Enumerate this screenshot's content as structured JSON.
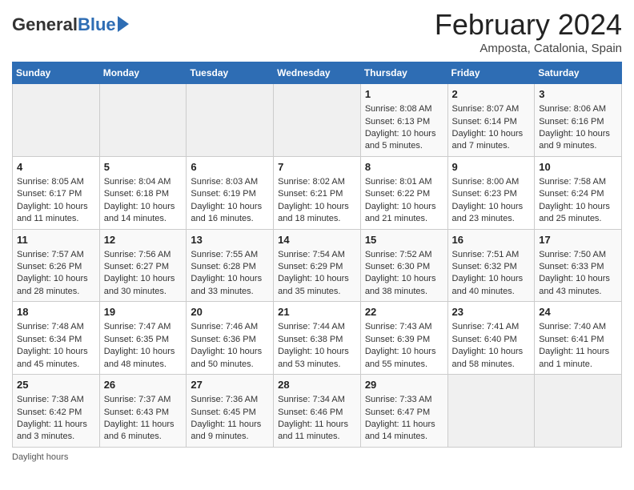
{
  "header": {
    "logo_general": "General",
    "logo_blue": "Blue",
    "month_year": "February 2024",
    "location": "Amposta, Catalonia, Spain"
  },
  "days_of_week": [
    "Sunday",
    "Monday",
    "Tuesday",
    "Wednesday",
    "Thursday",
    "Friday",
    "Saturday"
  ],
  "weeks": [
    [
      {
        "day": "",
        "info": ""
      },
      {
        "day": "",
        "info": ""
      },
      {
        "day": "",
        "info": ""
      },
      {
        "day": "",
        "info": ""
      },
      {
        "day": "1",
        "info": "Sunrise: 8:08 AM\nSunset: 6:13 PM\nDaylight: 10 hours and 5 minutes."
      },
      {
        "day": "2",
        "info": "Sunrise: 8:07 AM\nSunset: 6:14 PM\nDaylight: 10 hours and 7 minutes."
      },
      {
        "day": "3",
        "info": "Sunrise: 8:06 AM\nSunset: 6:16 PM\nDaylight: 10 hours and 9 minutes."
      }
    ],
    [
      {
        "day": "4",
        "info": "Sunrise: 8:05 AM\nSunset: 6:17 PM\nDaylight: 10 hours and 11 minutes."
      },
      {
        "day": "5",
        "info": "Sunrise: 8:04 AM\nSunset: 6:18 PM\nDaylight: 10 hours and 14 minutes."
      },
      {
        "day": "6",
        "info": "Sunrise: 8:03 AM\nSunset: 6:19 PM\nDaylight: 10 hours and 16 minutes."
      },
      {
        "day": "7",
        "info": "Sunrise: 8:02 AM\nSunset: 6:21 PM\nDaylight: 10 hours and 18 minutes."
      },
      {
        "day": "8",
        "info": "Sunrise: 8:01 AM\nSunset: 6:22 PM\nDaylight: 10 hours and 21 minutes."
      },
      {
        "day": "9",
        "info": "Sunrise: 8:00 AM\nSunset: 6:23 PM\nDaylight: 10 hours and 23 minutes."
      },
      {
        "day": "10",
        "info": "Sunrise: 7:58 AM\nSunset: 6:24 PM\nDaylight: 10 hours and 25 minutes."
      }
    ],
    [
      {
        "day": "11",
        "info": "Sunrise: 7:57 AM\nSunset: 6:26 PM\nDaylight: 10 hours and 28 minutes."
      },
      {
        "day": "12",
        "info": "Sunrise: 7:56 AM\nSunset: 6:27 PM\nDaylight: 10 hours and 30 minutes."
      },
      {
        "day": "13",
        "info": "Sunrise: 7:55 AM\nSunset: 6:28 PM\nDaylight: 10 hours and 33 minutes."
      },
      {
        "day": "14",
        "info": "Sunrise: 7:54 AM\nSunset: 6:29 PM\nDaylight: 10 hours and 35 minutes."
      },
      {
        "day": "15",
        "info": "Sunrise: 7:52 AM\nSunset: 6:30 PM\nDaylight: 10 hours and 38 minutes."
      },
      {
        "day": "16",
        "info": "Sunrise: 7:51 AM\nSunset: 6:32 PM\nDaylight: 10 hours and 40 minutes."
      },
      {
        "day": "17",
        "info": "Sunrise: 7:50 AM\nSunset: 6:33 PM\nDaylight: 10 hours and 43 minutes."
      }
    ],
    [
      {
        "day": "18",
        "info": "Sunrise: 7:48 AM\nSunset: 6:34 PM\nDaylight: 10 hours and 45 minutes."
      },
      {
        "day": "19",
        "info": "Sunrise: 7:47 AM\nSunset: 6:35 PM\nDaylight: 10 hours and 48 minutes."
      },
      {
        "day": "20",
        "info": "Sunrise: 7:46 AM\nSunset: 6:36 PM\nDaylight: 10 hours and 50 minutes."
      },
      {
        "day": "21",
        "info": "Sunrise: 7:44 AM\nSunset: 6:38 PM\nDaylight: 10 hours and 53 minutes."
      },
      {
        "day": "22",
        "info": "Sunrise: 7:43 AM\nSunset: 6:39 PM\nDaylight: 10 hours and 55 minutes."
      },
      {
        "day": "23",
        "info": "Sunrise: 7:41 AM\nSunset: 6:40 PM\nDaylight: 10 hours and 58 minutes."
      },
      {
        "day": "24",
        "info": "Sunrise: 7:40 AM\nSunset: 6:41 PM\nDaylight: 11 hours and 1 minute."
      }
    ],
    [
      {
        "day": "25",
        "info": "Sunrise: 7:38 AM\nSunset: 6:42 PM\nDaylight: 11 hours and 3 minutes."
      },
      {
        "day": "26",
        "info": "Sunrise: 7:37 AM\nSunset: 6:43 PM\nDaylight: 11 hours and 6 minutes."
      },
      {
        "day": "27",
        "info": "Sunrise: 7:36 AM\nSunset: 6:45 PM\nDaylight: 11 hours and 9 minutes."
      },
      {
        "day": "28",
        "info": "Sunrise: 7:34 AM\nSunset: 6:46 PM\nDaylight: 11 hours and 11 minutes."
      },
      {
        "day": "29",
        "info": "Sunrise: 7:33 AM\nSunset: 6:47 PM\nDaylight: 11 hours and 14 minutes."
      },
      {
        "day": "",
        "info": ""
      },
      {
        "day": "",
        "info": ""
      }
    ]
  ],
  "footer": {
    "note": "Daylight hours"
  }
}
